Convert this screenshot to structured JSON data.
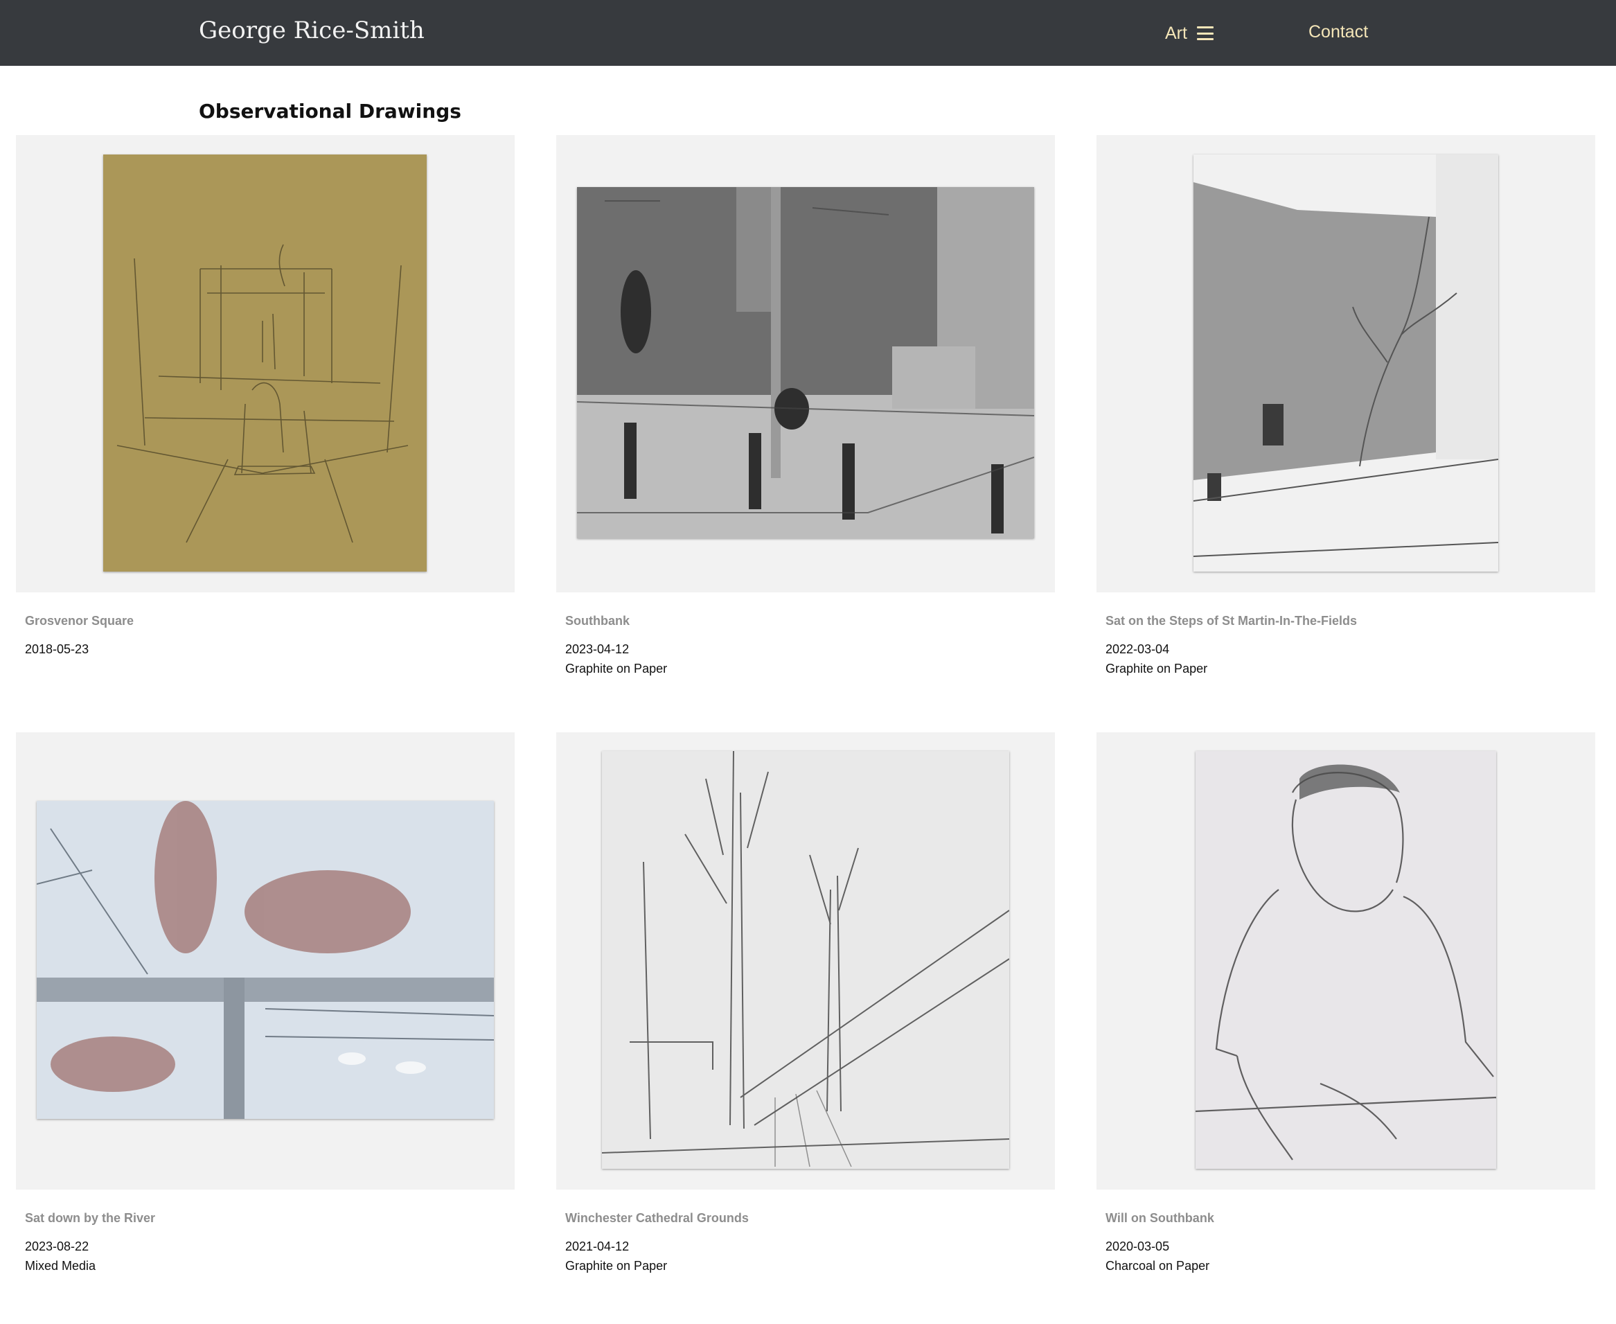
{
  "header": {
    "brand": "George Rice-Smith",
    "nav": {
      "art_label": "Art",
      "art_icon": "hamburger-menu-icon",
      "contact_label": "Contact"
    },
    "colors": {
      "bar": "#373a3e",
      "brand_text": "#f2f2f2",
      "nav_text": "#f5e6b8"
    }
  },
  "page": {
    "title": "Observational Drawings"
  },
  "artworks": [
    {
      "title": "Grosvenor Square",
      "date": "2018-05-23",
      "medium": ""
    },
    {
      "title": "Southbank",
      "date": "2023-04-12",
      "medium": "Graphite on Paper"
    },
    {
      "title": "Sat on the Steps of St Martin-In-The-Fields",
      "date": "2022-03-04",
      "medium": "Graphite on Paper"
    },
    {
      "title": "Sat down by the River",
      "date": "2023-08-22",
      "medium": "Mixed Media"
    },
    {
      "title": "Winchester Cathedral Grounds",
      "date": "2021-04-12",
      "medium": "Graphite on Paper"
    },
    {
      "title": "Will on Southbank",
      "date": "2020-03-05",
      "medium": "Charcoal on Paper"
    }
  ]
}
